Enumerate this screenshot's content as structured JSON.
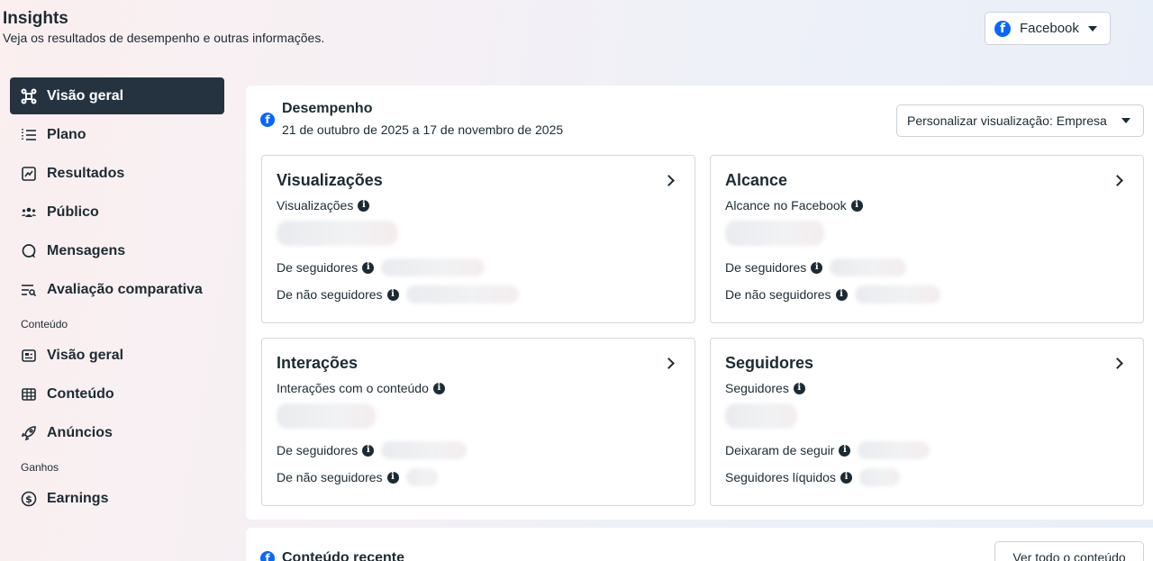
{
  "header": {
    "title": "Insights",
    "subtitle": "Veja os resultados de desempenho e outras informações."
  },
  "platform_selector": {
    "label": "Facebook",
    "icon": "facebook-icon"
  },
  "sidebar": {
    "items": [
      {
        "label": "Visão geral",
        "icon": "overview-icon",
        "active": true
      },
      {
        "label": "Plano",
        "icon": "list-icon"
      },
      {
        "label": "Resultados",
        "icon": "chart-icon"
      },
      {
        "label": "Público",
        "icon": "people-icon"
      },
      {
        "label": "Mensagens",
        "icon": "chat-icon"
      },
      {
        "label": "Avaliação comparativa",
        "icon": "benchmark-icon"
      }
    ],
    "content_section": "Conteúdo",
    "content_items": [
      {
        "label": "Visão geral",
        "icon": "media-icon"
      },
      {
        "label": "Conteúdo",
        "icon": "table-icon"
      },
      {
        "label": "Anúncios",
        "icon": "rocket-icon"
      }
    ],
    "earnings_section": "Ganhos",
    "earnings_items": [
      {
        "label": "Earnings",
        "icon": "dollar-icon"
      }
    ]
  },
  "performance": {
    "title": "Desempenho",
    "date_range": "21 de outubro de 2025 a 17 de novembro de 2025",
    "customize_label": "Personalizar visualização: Empresa",
    "cards": [
      {
        "title": "Visualizações",
        "metric": "Visualizações",
        "row1": "De seguidores",
        "row2": "De não seguidores"
      },
      {
        "title": "Alcance",
        "metric": "Alcance no Facebook",
        "row1": "De seguidores",
        "row2": "De não seguidores"
      },
      {
        "title": "Interações",
        "metric": "Interações com o conteúdo",
        "row1": "De seguidores",
        "row2": "De não seguidores"
      },
      {
        "title": "Seguidores",
        "metric": "Seguidores",
        "row1": "Deixaram de seguir",
        "row2": "Seguidores líquidos"
      }
    ]
  },
  "recent_content": {
    "title": "Conteúdo recente",
    "see_all_label": "Ver todo o conteúdo"
  },
  "colors": {
    "facebook_blue": "#0866ff",
    "active_nav_bg": "#253341",
    "text": "#1c2b33"
  }
}
